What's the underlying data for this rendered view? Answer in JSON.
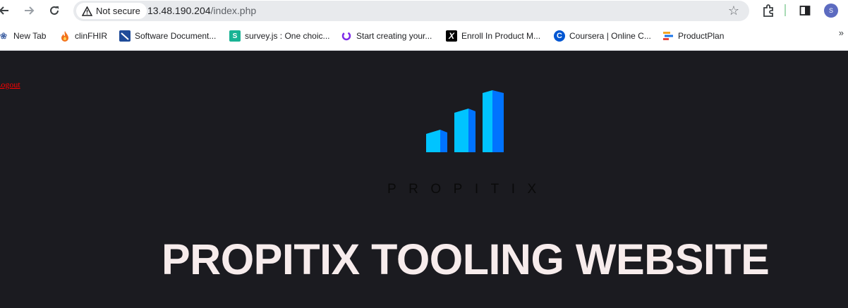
{
  "browser": {
    "security_label": "Not secure",
    "url_host": "13.48.190.204",
    "url_path": "/index.php",
    "profile_initial": "S"
  },
  "bookmarks": [
    {
      "label": "New Tab",
      "icon": "new-tab-icon"
    },
    {
      "label": "clinFHIR",
      "icon": "flame-icon"
    },
    {
      "label": "Software Document...",
      "icon": "software-doc-icon"
    },
    {
      "label": "survey.js : One choic...",
      "icon": "surveyjs-icon"
    },
    {
      "label": "Start creating your...",
      "icon": "canva-icon"
    },
    {
      "label": "Enroll In Product M...",
      "icon": "x-icon"
    },
    {
      "label": "Coursera | Online C...",
      "icon": "coursera-icon"
    },
    {
      "label": "ProductPlan",
      "icon": "productplan-icon"
    }
  ],
  "page": {
    "logout_label": "Logout",
    "logo_wordmark": "PROPITIX",
    "headline": "PROPITIX TOOLING WEBSITE"
  },
  "colors": {
    "background": "#1b1b20",
    "headline": "#f7ecec",
    "logout_link": "#ff0000",
    "logo_light_blue": "#00c4ff",
    "logo_dark_blue": "#0073ff"
  }
}
